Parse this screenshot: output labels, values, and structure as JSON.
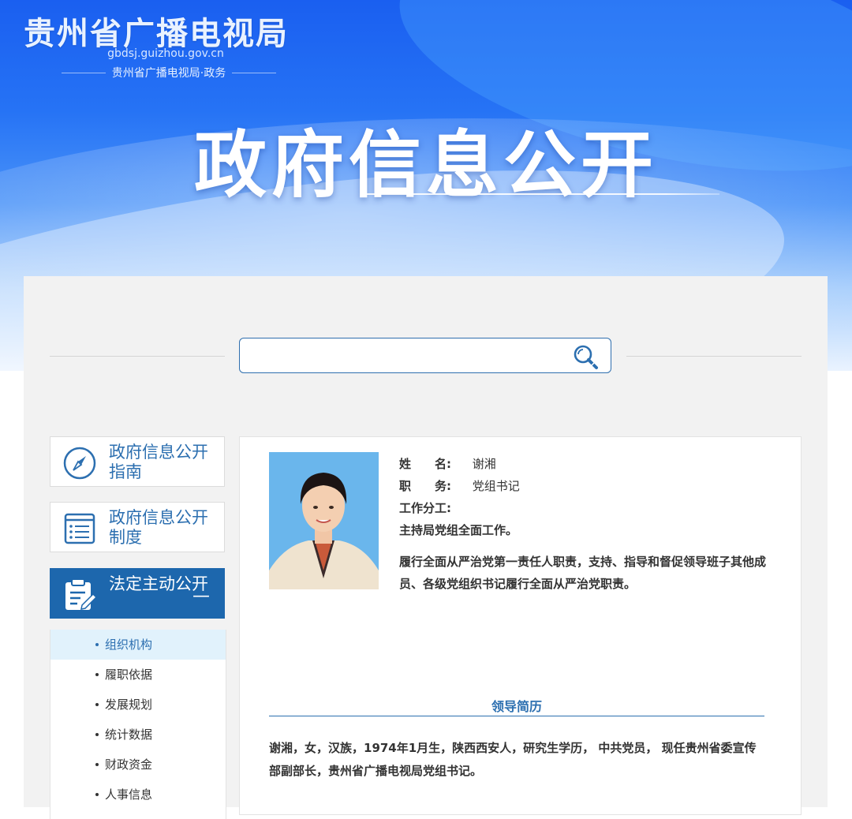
{
  "header": {
    "site_name": "贵州省广播电视局",
    "domain": "gbdsj.guizhou.gov.cn",
    "subtitle": "贵州省广播电视局·政务",
    "page_title": "政府信息公开"
  },
  "search": {
    "placeholder": "",
    "value": "",
    "icon": "search-icon"
  },
  "sidebar": {
    "cards": [
      {
        "label": "政府信息公开指南",
        "icon": "compass-icon"
      },
      {
        "label": "政府信息公开制度",
        "icon": "list-icon"
      },
      {
        "label": "法定主动公开",
        "icon": "clipboard-edit-icon",
        "toggle": "—"
      }
    ],
    "items": [
      {
        "label": "组织机构",
        "active": true
      },
      {
        "label": "履职依据"
      },
      {
        "label": "发展规划"
      },
      {
        "label": "统计数据"
      },
      {
        "label": "财政资金"
      },
      {
        "label": "人事信息"
      }
    ]
  },
  "leader": {
    "name_label": "姓　　名:",
    "name": "谢湘",
    "position_label": "职　　务:",
    "position": "党组书记",
    "duty_label": "工作分工:",
    "duty": "主持局党组全面工作。",
    "desc": "履行全面从严治党第一责任人职责，支持、指导和督促领导班子其他成员、各级党组织书记履行全面从严治党职责。",
    "resume_title": "领导简历",
    "resume": "谢湘，女，汉族，1974年1月生，陕西西安人，研究生学历， 中共党员， 现任贵州省委宣传部副部长，贵州省广播电视局党组书记。"
  },
  "colors": {
    "accent": "#2c6fb0",
    "active_card": "#1d67ad",
    "active_item_bg": "#e1f2fc"
  }
}
